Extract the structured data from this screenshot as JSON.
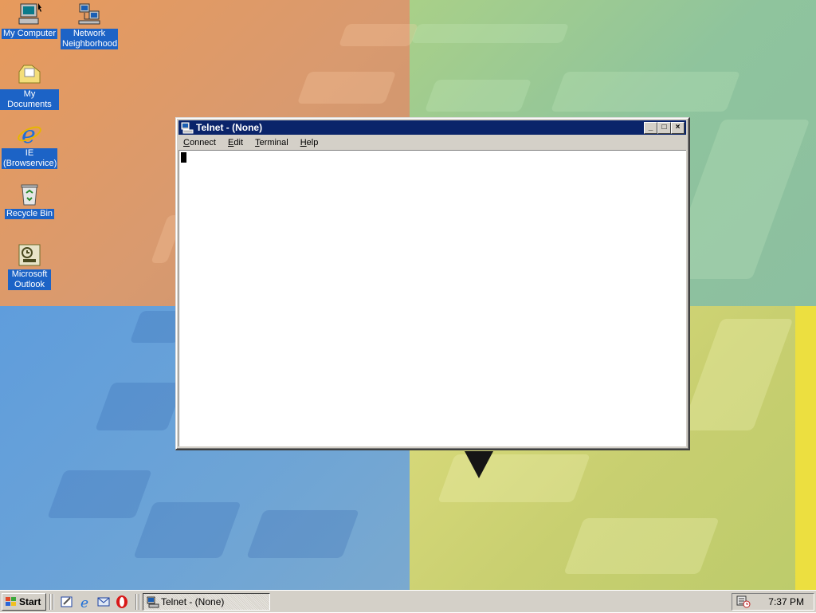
{
  "desktop": {
    "icons": [
      {
        "name": "my-computer",
        "label": "My Computer",
        "icon": "computer-icon"
      },
      {
        "name": "network-neighborhood",
        "label": "Network Neighborhood",
        "icon": "network-icon"
      },
      {
        "name": "my-documents",
        "label": "My Documents",
        "icon": "folder-icon"
      },
      {
        "name": "ie-browservice",
        "label": "IE (Browservice)",
        "icon": "internet-explorer-icon"
      },
      {
        "name": "recycle-bin",
        "label": "Recycle Bin",
        "icon": "recycle-bin-icon"
      },
      {
        "name": "microsoft-outlook",
        "label": "Microsoft Outlook",
        "icon": "outlook-icon"
      }
    ]
  },
  "window": {
    "title": "Telnet - (None)",
    "controls": {
      "minimize": "_",
      "maximize": "□",
      "close": "×"
    },
    "menu": [
      "Connect",
      "Edit",
      "Terminal",
      "Help"
    ]
  },
  "taskbar": {
    "start_label": "Start",
    "quick_launch": [
      "show-desktop-icon",
      "internet-explorer-icon",
      "outlook-express-icon",
      "opera-icon"
    ],
    "task_button": "Telnet - (None)",
    "clock": "7:37 PM"
  },
  "colors": {
    "titlebar": "#0a246a",
    "face": "#d4d0c8",
    "icon_label_bg": "#1c63c6"
  }
}
